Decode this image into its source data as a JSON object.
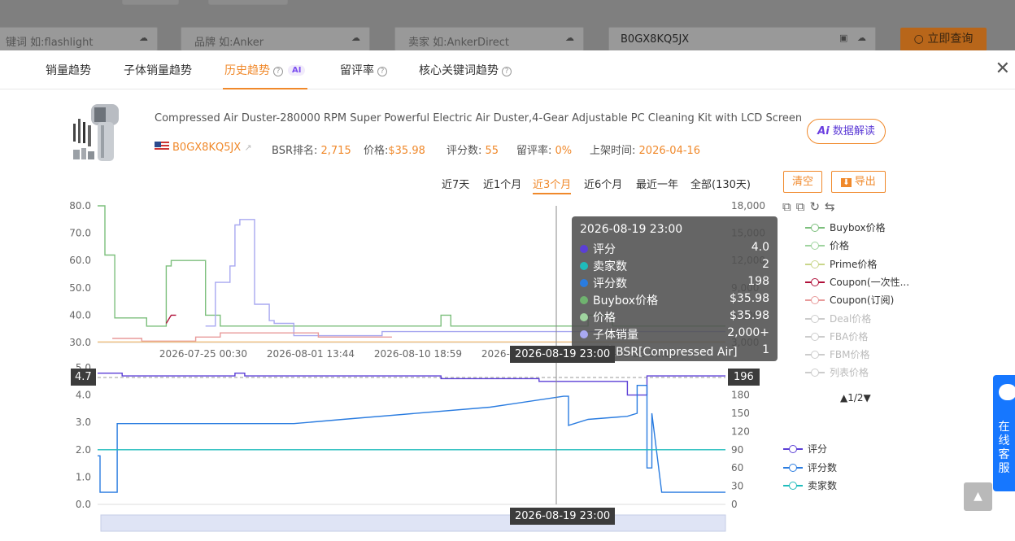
{
  "search": {
    "keyword_placeholder": "键词 如:flashlight",
    "brand_placeholder": "品牌 如:Anker",
    "seller_placeholder": "卖家 如:AnkerDirect",
    "asin_value": "B0GX8KQ5JX",
    "query_label": "立即查询"
  },
  "tabs": [
    {
      "label": "销量趋势"
    },
    {
      "label": "子体销量趋势"
    },
    {
      "label": "历史趋势",
      "badge": "AI"
    },
    {
      "label": "留评率"
    },
    {
      "label": "核心关键词趋势"
    }
  ],
  "product": {
    "title": "Compressed Air Duster-280000 RPM Super Powerful Electric Air Duster,4-Gear Adjustable PC Cleaning Kit with LCD Screen & ...",
    "asin": "B0GX8KQ5JX",
    "bsr_label": "BSR排名:",
    "bsr_value": "2,715",
    "price_label": "价格:",
    "price_value": "$35.98",
    "rating_count_label": "评分数:",
    "rating_count_value": "55",
    "review_rate_label": "留评率:",
    "review_rate_value": "0%",
    "launch_label": "上架时间:",
    "launch_value": "2026-04-16",
    "ai_button": "数据解读"
  },
  "ranges": [
    "近7天",
    "近1个月",
    "近3个月",
    "近6个月",
    "最近一年",
    "全部(130天)"
  ],
  "actions": {
    "clear": "清空",
    "export": "导出"
  },
  "legend_top": [
    {
      "label": "Buybox价格",
      "color": "#7cbf7c",
      "dim": false
    },
    {
      "label": "价格",
      "color": "#9fd49f",
      "dim": false
    },
    {
      "label": "Prime价格",
      "color": "#c9d68a",
      "dim": false
    },
    {
      "label": "Coupon(一次性...",
      "color": "#b0103a",
      "dim": false
    },
    {
      "label": "Coupon(订阅)",
      "color": "#e89a9a",
      "dim": false
    },
    {
      "label": "Deal价格",
      "color": "#cccccc",
      "dim": true
    },
    {
      "label": "FBA价格",
      "color": "#cccccc",
      "dim": true
    },
    {
      "label": "FBM价格",
      "color": "#cccccc",
      "dim": true
    },
    {
      "label": "列表价格",
      "color": "#cccccc",
      "dim": true
    }
  ],
  "legend_pager": "▲1/2▼",
  "legend_bottom": [
    {
      "label": "评分",
      "color": "#5b3fd6"
    },
    {
      "label": "评分数",
      "color": "#2a7ce0"
    },
    {
      "label": "卖家数",
      "color": "#1fbcbc"
    }
  ],
  "tooltip": {
    "title": "2026-08-19 23:00",
    "rows": [
      {
        "label": "评分",
        "value": "4.0",
        "color": "#5b3fd6"
      },
      {
        "label": "卖家数",
        "value": "2",
        "color": "#1fbcbc"
      },
      {
        "label": "评分数",
        "value": "198",
        "color": "#2a7ce0"
      },
      {
        "label": "Buybox价格",
        "value": "$35.98",
        "color": "#6fb36f"
      },
      {
        "label": "价格",
        "value": "$35.98",
        "color": "#9fd49f"
      },
      {
        "label": "子体销量",
        "value": "2,000+",
        "color": "#a8a8f0"
      },
      {
        "label": "小类BSR[Compressed Air]",
        "value": "1",
        "color": "#f0b070"
      }
    ]
  },
  "axis_flags": {
    "top_x": "2026-08-19 23:00",
    "bottom_x": "2026-08-19 23:00",
    "left_y": "4.7",
    "right_y": "196"
  },
  "chat_widget": "在线客服",
  "chart_data": [
    {
      "type": "line",
      "title": "",
      "x_ticks": [
        "2026-07-25 00:30",
        "2026-08-01 13:44",
        "2026-08-10 18:59",
        "2026-08-19 23:00",
        "2026-08-22 00:00"
      ],
      "y_left_ticks": [
        30.0,
        40.0,
        50.0,
        60.0,
        70.0,
        80.0
      ],
      "y_right_ticks": [
        "3,000",
        "6,000",
        "9,000",
        "12,000",
        "15,000",
        "18,000"
      ],
      "ylim_left": [
        30,
        80
      ],
      "ylim_right": [
        0,
        18000
      ],
      "series": [
        {
          "name": "Buybox价格",
          "color": "#7cbf7c",
          "axis": "left",
          "points": [
            [
              0,
              80
            ],
            [
              1.5,
              80
            ],
            [
              1.5,
              62
            ],
            [
              3.5,
              62
            ],
            [
              3.5,
              39
            ],
            [
              10,
              39
            ],
            [
              10,
              35.98
            ],
            [
              14,
              35.98
            ],
            [
              14,
              58
            ],
            [
              15,
              58
            ],
            [
              15,
              60
            ],
            [
              22,
              60
            ],
            [
              22,
              40
            ],
            [
              25,
              40
            ],
            [
              25,
              36
            ],
            [
              70,
              36
            ],
            [
              70,
              40
            ],
            [
              72,
              40
            ],
            [
              72,
              36
            ],
            [
              100,
              36
            ],
            [
              100,
              40
            ],
            [
              105,
              40
            ],
            [
              105,
              36
            ],
            [
              128,
              36
            ]
          ]
        },
        {
          "name": "子体销量",
          "color": "#a8a8f0",
          "axis": "left",
          "points": [
            [
              22,
              36
            ],
            [
              24,
              36
            ],
            [
              24,
              52
            ],
            [
              27,
              52
            ],
            [
              27,
              58
            ],
            [
              28,
              58
            ],
            [
              28,
              73
            ],
            [
              29,
              73
            ],
            [
              29,
              75
            ],
            [
              32,
              75
            ],
            [
              32,
              44
            ],
            [
              35,
              44
            ],
            [
              35,
              38
            ],
            [
              36,
              38
            ],
            [
              36,
              37
            ],
            [
              40,
              37
            ],
            [
              40,
              32.5
            ],
            [
              58,
              32.5
            ],
            [
              58,
              34
            ],
            [
              128,
              34
            ]
          ]
        },
        {
          "name": "Coupon(一次性...",
          "color": "#b0103a",
          "axis": "left",
          "points": [
            [
              14,
              37
            ],
            [
              15,
              40
            ],
            [
              16,
              40
            ]
          ]
        },
        {
          "name": "Coupon(订阅)",
          "color": "#e89a9a",
          "axis": "left",
          "points": [
            [
              3,
              31.5
            ],
            [
              9,
              31.5
            ],
            [
              9,
              30.5
            ],
            [
              20,
              30.5
            ],
            [
              20,
              32
            ],
            [
              25,
              32
            ],
            [
              25,
              33.5
            ],
            [
              45,
              33.5
            ],
            [
              45,
              32
            ],
            [
              60,
              32
            ]
          ]
        },
        {
          "name": "小类BSR[Compressed Air]",
          "color": "#f0c080",
          "axis": "left",
          "points": [
            [
              0,
              30.2
            ],
            [
              128,
              30.2
            ]
          ]
        }
      ]
    },
    {
      "type": "line",
      "title": "",
      "y_left_ticks": [
        0.0,
        1.0,
        2.0,
        3.0,
        4.0,
        5.0
      ],
      "y_right_ticks": [
        0,
        30,
        60,
        90,
        120,
        150,
        180,
        210
      ],
      "ylim_left": [
        0,
        5
      ],
      "ylim_right": [
        0,
        225
      ],
      "series": [
        {
          "name": "评分",
          "color": "#5b3fd6",
          "axis": "left",
          "points": [
            [
              0,
              4.8
            ],
            [
              5,
              4.8
            ],
            [
              5,
              4.7
            ],
            [
              28,
              4.7
            ],
            [
              28,
              4.8
            ],
            [
              30,
              4.8
            ],
            [
              30,
              4.7
            ],
            [
              70,
              4.7
            ],
            [
              70,
              4.6
            ],
            [
              90,
              4.6
            ],
            [
              90,
              4.5
            ],
            [
              108,
              4.5
            ],
            [
              108,
              4.0
            ],
            [
              112,
              4.0
            ],
            [
              112,
              4.7
            ],
            [
              128,
              4.7
            ]
          ]
        },
        {
          "name": "评分数",
          "color": "#2a7ce0",
          "axis": "right",
          "points": [
            [
              0,
              80
            ],
            [
              0.5,
              80
            ],
            [
              0.5,
              20
            ],
            [
              4,
              20
            ],
            [
              4,
              133
            ],
            [
              40,
              133
            ],
            [
              50,
              140
            ],
            [
              80,
              160
            ],
            [
              95,
              178
            ],
            [
              96,
              178
            ],
            [
              96,
              130
            ],
            [
              100,
              140
            ],
            [
              108,
              145
            ],
            [
              110,
              150
            ],
            [
              110,
              196
            ],
            [
              112,
              196
            ],
            [
              112,
              60
            ],
            [
              113,
              60
            ],
            [
              113,
              150
            ],
            [
              115,
              20
            ],
            [
              128,
              20
            ]
          ]
        },
        {
          "name": "卖家数",
          "color": "#1fbcbc",
          "axis": "left",
          "points": [
            [
              0,
              2
            ],
            [
              128,
              2
            ]
          ]
        }
      ]
    }
  ]
}
